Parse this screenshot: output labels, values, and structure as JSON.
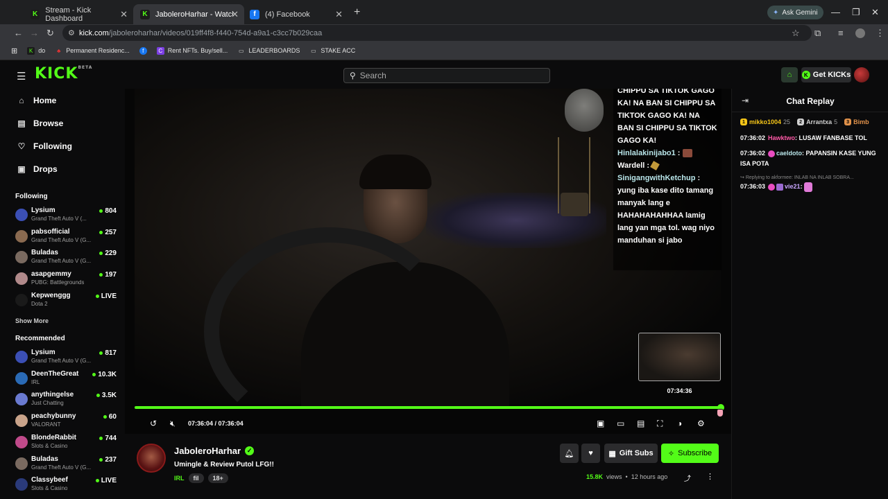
{
  "browser": {
    "tabs": [
      {
        "label": "Stream - Kick Dashboard",
        "favicon": "kick-icon",
        "active": false
      },
      {
        "label": "JaboleroHarhar - Watch the VO",
        "favicon": "kick-icon",
        "active": true
      },
      {
        "label": "(4) Facebook",
        "favicon": "facebook-icon",
        "active": false
      }
    ],
    "new_tab": "+",
    "ask_gemini": "Ask Gemini",
    "url_host": "kick.com",
    "url_path": "/jaboleroharhar/videos/019ff4f8-f440-754d-a9a1-c3cc7b029caa",
    "bookmarks": [
      {
        "label": "do",
        "icon": "kick-icon"
      },
      {
        "label": "Permanent Residenc...",
        "icon": "maple-leaf-icon"
      },
      {
        "label": "",
        "icon": "facebook-icon"
      },
      {
        "label": "Rent NFTs. Buy/sell...",
        "icon": "nft-icon"
      },
      {
        "label": "LEADERBOARDS",
        "icon": "folder-icon"
      },
      {
        "label": "STAKE ACC",
        "icon": "folder-icon"
      }
    ]
  },
  "header": {
    "logo": "KICK",
    "logo_badge": "BETA",
    "search_placeholder": "Search",
    "get_kicks": "Get KICKs"
  },
  "sidebar": {
    "nav": [
      {
        "label": "Home",
        "icon": "home-icon"
      },
      {
        "label": "Browse",
        "icon": "browse-icon"
      },
      {
        "label": "Following",
        "icon": "heart-icon"
      },
      {
        "label": "Drops",
        "icon": "drops-icon"
      }
    ],
    "following_heading": "Following",
    "following": [
      {
        "name": "Lysium",
        "category": "Grand Theft Auto V (...",
        "viewers": "804",
        "color": "#3b4fb5"
      },
      {
        "name": "pabsofficial",
        "category": "Grand Theft Auto V (G...",
        "viewers": "257",
        "color": "#8a6a50"
      },
      {
        "name": "Buladas",
        "category": "Grand Theft Auto V (G...",
        "viewers": "229",
        "color": "#7a6a60"
      },
      {
        "name": "asapgemmy",
        "category": "PUBG: Battlegrounds",
        "viewers": "197",
        "color": "#b0898a"
      },
      {
        "name": "Kepwenggg",
        "category": "Dota 2",
        "viewers": "LIVE",
        "color": "#1a1a1a"
      }
    ],
    "show_more": "Show More",
    "recommended_heading": "Recommended",
    "recommended": [
      {
        "name": "Lysium",
        "category": "Grand Theft Auto V (G...",
        "viewers": "817",
        "color": "#3b4fb5"
      },
      {
        "name": "DeenTheGreat",
        "category": "IRL",
        "viewers": "10.3K",
        "color": "#2a6ab5"
      },
      {
        "name": "anythingelse",
        "category": "Just Chatting",
        "viewers": "3.5K",
        "color": "#6a7ad0"
      },
      {
        "name": "peachybunny",
        "category": "VALORANT",
        "viewers": "60",
        "color": "#c9a38a"
      },
      {
        "name": "BlondeRabbit",
        "category": "Slots & Casino",
        "viewers": "744",
        "color": "#c04a8a"
      },
      {
        "name": "Buladas",
        "category": "Grand Theft Auto V (G...",
        "viewers": "237",
        "color": "#7a6a60"
      },
      {
        "name": "Classybeef",
        "category": "Slots & Casino",
        "viewers": "LIVE",
        "color": "#2a3a7a"
      }
    ]
  },
  "video": {
    "overlay_chat": {
      "top_text": "CHIPPU SA TIKTOK GAGO KA! NA BAN SI CHIPPU SA TIKTOK GAGO KA! NA BAN SI CHIPPU SA TIKTOK GAGO KA!",
      "messages": [
        {
          "user": "Hinlalakinijabo1",
          "text": ""
        },
        {
          "user": "Wardell",
          "text": ""
        },
        {
          "user": "SinigangwithKetchup",
          "text": "yung iba kase dito tamang manyak lang e HAHAHAHAHHAA lamig lang yan mga tol. wag niyo manduhan si jabo"
        }
      ]
    },
    "preview_time": "07:34:36",
    "current_time": "07:36:04",
    "duration": "07:36:04",
    "progress": 1.0
  },
  "chat": {
    "title": "Chat Replay",
    "leaders": [
      {
        "rank": "1",
        "name": "mikko1004",
        "count": "25",
        "color": "#f5c518"
      },
      {
        "rank": "2",
        "name": "Arrantxa",
        "count": "5",
        "color": "#d0d0d0"
      },
      {
        "rank": "3",
        "name": "Bimb",
        "count": "",
        "color": "#e0914a"
      }
    ],
    "messages": [
      {
        "time": "07:36:02",
        "user": "Hawktwo",
        "text": "LUSAW FANBASE TOL",
        "color": "#ff5aa8"
      },
      {
        "time": "07:36:02",
        "user": "caeldoto",
        "text": "PAPANSIN KASE YUNG ISA POTA",
        "color": "#b9e6ea"
      },
      {
        "time": "07:36:03",
        "user": "vie21",
        "text": "",
        "color": "#c9a6ff"
      }
    ],
    "reply_note": "Replying to akformee: INLAB NA INLAB SOBRA..."
  },
  "info": {
    "streamer": "JaboleroHarhar",
    "title": "Umingle & Review Putol LFG!!",
    "category": "IRL",
    "tags": [
      "fil",
      "18+"
    ],
    "gift_subs": "Gift Subs",
    "subscribe": "Subscribe",
    "views": "15.8K",
    "views_label": "views",
    "separator": "•",
    "ago": "12 hours ago"
  },
  "colors": {
    "accent": "#53fc18",
    "bg": "#0b0b0c"
  }
}
